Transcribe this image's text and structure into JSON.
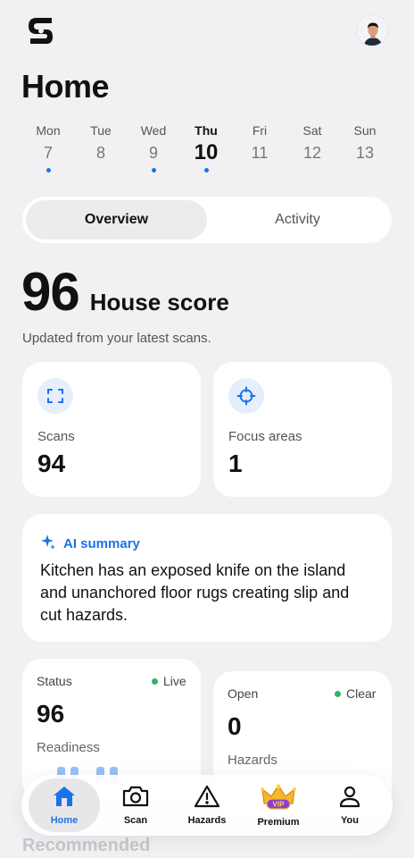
{
  "header": {
    "title": "Home",
    "logo_icon": "logo-s-icon",
    "avatar_icon": "user-avatar-icon"
  },
  "week": [
    {
      "name": "Mon",
      "num": "7",
      "dot": true,
      "active": false
    },
    {
      "name": "Tue",
      "num": "8",
      "dot": false,
      "active": false
    },
    {
      "name": "Wed",
      "num": "9",
      "dot": true,
      "active": false
    },
    {
      "name": "Thu",
      "num": "10",
      "dot": true,
      "active": true
    },
    {
      "name": "Fri",
      "num": "11",
      "dot": false,
      "active": false
    },
    {
      "name": "Sat",
      "num": "12",
      "dot": false,
      "active": false
    },
    {
      "name": "Sun",
      "num": "13",
      "dot": false,
      "active": false
    }
  ],
  "segment": {
    "overview": "Overview",
    "activity": "Activity",
    "selected": "Overview"
  },
  "score": {
    "value": "96",
    "label": "House score",
    "subtitle": "Updated from your latest scans."
  },
  "stats": {
    "scans": {
      "label": "Scans",
      "value": "94",
      "icon": "scan-frame-icon"
    },
    "focus": {
      "label": "Focus areas",
      "value": "1",
      "icon": "crosshair-icon"
    }
  },
  "ai_summary": {
    "label": "AI summary",
    "icon": "sparkle-icon",
    "text": "Kitchen has an exposed knife on the island and unanchored floor rugs creating slip and cut hazards."
  },
  "status_card": {
    "label": "Status",
    "badge": "Live",
    "value": "96",
    "sub": "Readiness"
  },
  "open_card": {
    "label": "Open",
    "badge": "Clear",
    "value": "0",
    "sub": "Hazards"
  },
  "recommended": "Recommended",
  "tabs": [
    {
      "label": "Home",
      "icon": "home-icon"
    },
    {
      "label": "Scan",
      "icon": "camera-icon"
    },
    {
      "label": "Hazards",
      "icon": "warning-icon"
    },
    {
      "label": "Premium",
      "icon": "vip-crown-icon"
    },
    {
      "label": "You",
      "icon": "person-icon"
    }
  ],
  "colors": {
    "accent": "#1a73e8",
    "live_green": "#2fb36b",
    "background": "#f1f1f4"
  }
}
